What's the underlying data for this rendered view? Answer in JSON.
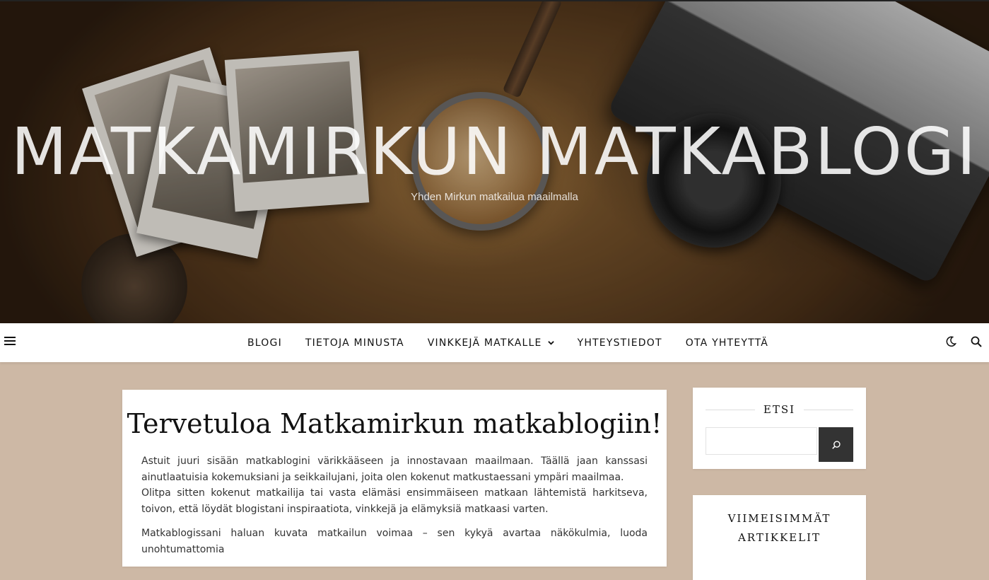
{
  "site": {
    "title": "MATKAMIRKUN MATKABLOGI",
    "tagline": "Yhden Mirkun matkailua maailmalla"
  },
  "nav": {
    "items": [
      {
        "label": "BLOGI"
      },
      {
        "label": "TIETOJA MINUSTA"
      },
      {
        "label": "VINKKEJÄ MATKALLE"
      },
      {
        "label": "YHTEYSTIEDOT"
      },
      {
        "label": "OTA YHTEYTTÄ"
      }
    ],
    "icons": [
      "menu-icon",
      "chevron-down-icon",
      "dark-mode-icon",
      "search-icon"
    ]
  },
  "post": {
    "title": "Tervetuloa Matkamirkun matkablogiin!",
    "p1": "Astuit juuri sisään matkablogini värikkääseen ja innostavaan maailmaan. Täällä jaan kanssasi ainutlaatuisia kokemuksiani ja seikkailujani, joita olen kokenut matkustaessani ympäri maailmaa.",
    "p2": "Olitpa sitten kokenut matkailija tai vasta elämäsi ensimmäiseen matkaan lähtemistä harkitseva, toivon, että löydät blogistani inspiraatiota, vinkkejä ja elämyksiä matkaasi varten.",
    "p3": "Matkablogissani haluan kuvata matkailun voimaa – sen kykyä avartaa näkökulmia, luoda unohtumattomia"
  },
  "sidebar": {
    "search_title": "ETSI",
    "search_value": "",
    "recent_title_line1": "VIIMEISIMMÄT",
    "recent_title_line2": "ARTIKKELIT"
  },
  "colors": {
    "background": "#cdb8a5",
    "search_button": "#333333"
  }
}
